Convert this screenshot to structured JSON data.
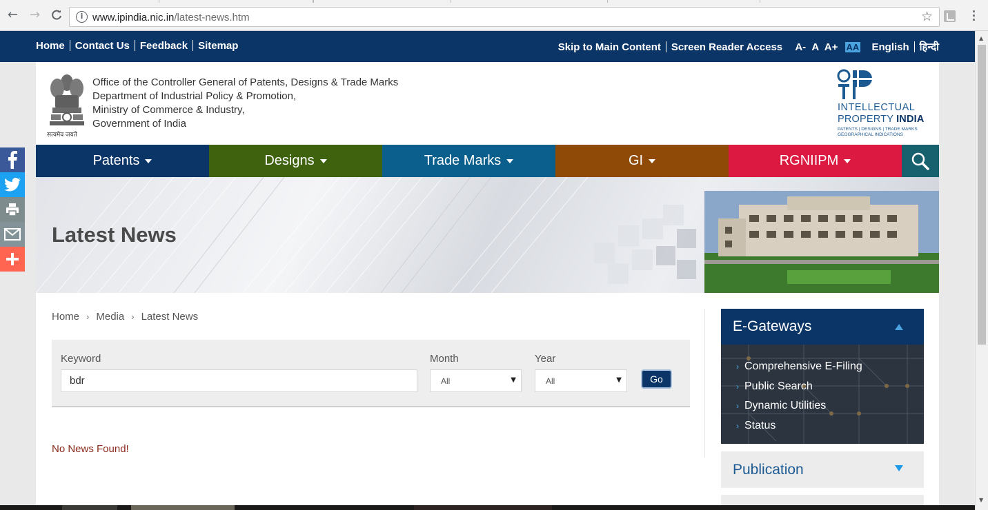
{
  "browser": {
    "url_host": "www.ipindia.nic.in",
    "url_path": "/latest-news.htm",
    "back_icon": "←",
    "forward_icon": "→",
    "reload_icon": "C",
    "star_icon": "☆",
    "menu_icon": "⋮"
  },
  "topbar": {
    "home": "Home",
    "contact": "Contact Us",
    "feedback": "Feedback",
    "sitemap": "Sitemap",
    "skip": "Skip to Main Content",
    "screen_reader": "Screen Reader Access",
    "font_minus": "A-",
    "font_normal": "A",
    "font_plus": "A+",
    "contrast": "AA",
    "english": "English",
    "hindi": "हिन्दी"
  },
  "header": {
    "line1": "Office of the Controller General of Patents, Designs & Trade Marks",
    "line2": "Department of Industrial Policy & Promotion,",
    "line3": "Ministry of Commerce & Industry,",
    "line4": "Government of India",
    "emblem_caption": "सत्यमेव जयते",
    "logo_line1": "INTELLECTUAL",
    "logo_line2a": "PROPERTY ",
    "logo_line2b": "INDIA",
    "logo_line3": "PATENTS | DESIGNS | TRADE MARKS",
    "logo_line4": "GEOGRAPHICAL INDICATIONS"
  },
  "nav": [
    {
      "label": "Patents",
      "color": "#0b3467"
    },
    {
      "label": "Designs",
      "color": "#3f620e"
    },
    {
      "label": "Trade Marks",
      "color": "#0a5f8d"
    },
    {
      "label": "GI",
      "color": "#8e4a06"
    },
    {
      "label": "RGNIIPM",
      "color": "#dc1a41"
    }
  ],
  "banner": {
    "title": "Latest News"
  },
  "breadcrumb": [
    "Home",
    "Media",
    "Latest News"
  ],
  "search": {
    "keyword_label": "Keyword",
    "keyword_value": "bdr",
    "month_label": "Month",
    "month_value": "All",
    "year_label": "Year",
    "year_value": "All",
    "go_label": "Go"
  },
  "result": {
    "message": "No News Found!"
  },
  "sidebar": {
    "egateways_title": "E-Gateways",
    "egateways_items": [
      "Comprehensive E-Filing",
      "Public Search",
      "Dynamic Utilities",
      "Status"
    ],
    "publication_title": "Publication"
  },
  "share": [
    {
      "icon": "facebook-icon",
      "color": "#3b5998"
    },
    {
      "icon": "twitter-icon",
      "color": "#1da1f2"
    },
    {
      "icon": "print-icon",
      "color": "#7f8c8d"
    },
    {
      "icon": "email-icon",
      "color": "#849397"
    },
    {
      "icon": "more-plus-icon",
      "color": "#ff6550"
    }
  ]
}
